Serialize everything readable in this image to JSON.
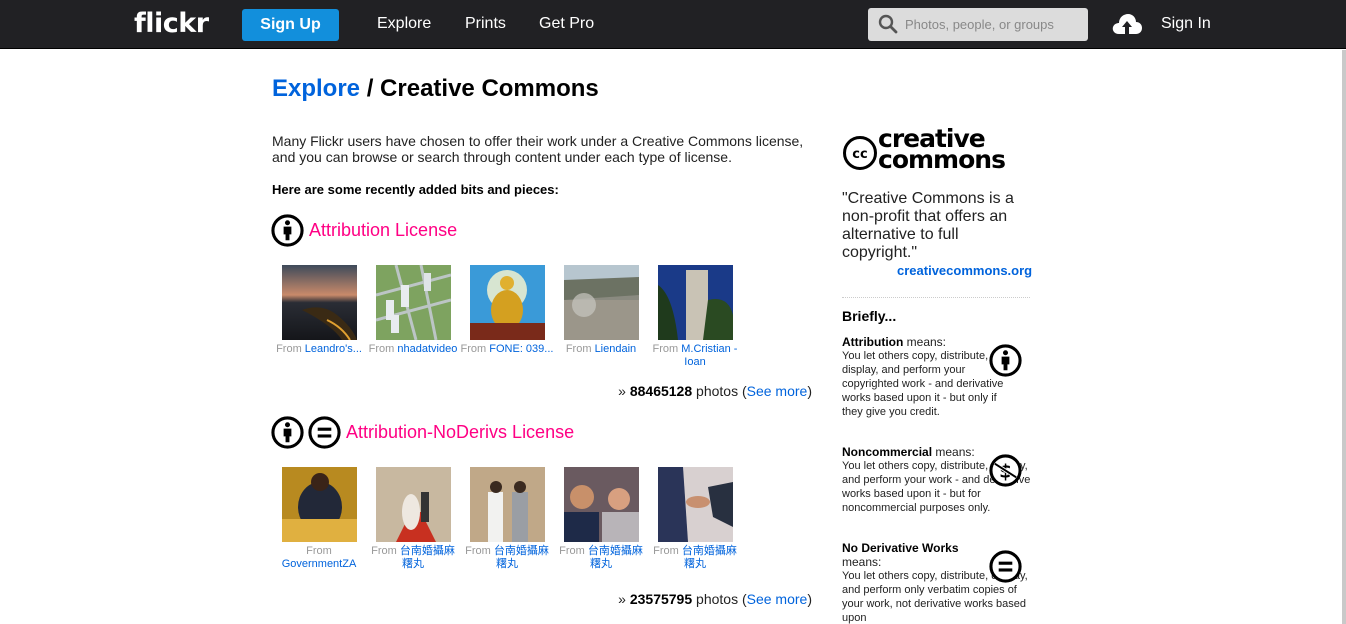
{
  "nav": {
    "logo": "flickr",
    "signup_label": "Sign Up",
    "links": [
      "Explore",
      "Prints",
      "Get Pro"
    ],
    "search_placeholder": "Photos, people, or groups",
    "signin_label": "Sign In",
    "upload_icon": "cloud-upload-icon",
    "search_icon": "search-icon",
    "accent_color": "#128fdc"
  },
  "header": {
    "breadcrumb_link": "Explore",
    "separator": " / ",
    "title": "Creative Commons"
  },
  "intro": "Many Flickr users have chosen to offer their work under a Creative Commons license, and you can browse or search through content under each type of license.",
  "recent_heading": "Here are some recently added bits and pieces:",
  "licenses": [
    {
      "title": "Attribution License",
      "icons": [
        "cc-by-icon"
      ],
      "photos": [
        {
          "from": "From ",
          "author": "Leandro's..."
        },
        {
          "from": "From ",
          "author": "nhadatvideo"
        },
        {
          "from": "From ",
          "author": "FONE: 039..."
        },
        {
          "from": "From ",
          "author": "Liendain"
        },
        {
          "from": "From ",
          "author": "M.Cristian - Ioan"
        }
      ],
      "count_prefix": "» ",
      "count": "88465128",
      "count_suffix": " photos (",
      "see_more": "See more",
      "close": ")"
    },
    {
      "title": "Attribution-NoDerivs License",
      "icons": [
        "cc-by-icon",
        "cc-nd-icon"
      ],
      "photos": [
        {
          "from": "From ",
          "author": "GovernmentZA"
        },
        {
          "from": "From ",
          "author": "台南婚攝麻糬丸"
        },
        {
          "from": "From ",
          "author": "台南婚攝麻糬丸"
        },
        {
          "from": "From ",
          "author": "台南婚攝麻糬丸"
        },
        {
          "from": "From ",
          "author": "台南婚攝麻糬丸"
        }
      ],
      "count_prefix": "» ",
      "count": "23575795",
      "count_suffix": " photos (",
      "see_more": "See more",
      "close": ")"
    }
  ],
  "sidebar": {
    "logo_text_1": "creative",
    "logo_text_2": "commons",
    "quote": "\"Creative Commons is a non-profit that offers an alternative to full copyright.\"",
    "link": "creativecommons.org",
    "briefly": "Briefly...",
    "terms": [
      {
        "name": "Attribution",
        "means": " means:",
        "desc": "You let others copy, distribute, display, and perform your copyrighted work - and derivative works based upon it - but only if they give you credit."
      },
      {
        "name": "Noncommercial",
        "means": " means:",
        "desc": "You let others copy, distribute, display, and perform your work - and derivative works based upon it - but for noncommercial purposes only."
      },
      {
        "name": "No Derivative Works",
        "means": " means:",
        "desc": "You let others copy, distribute, display, and perform only verbatim copies of your work, not derivative works based upon"
      }
    ]
  }
}
